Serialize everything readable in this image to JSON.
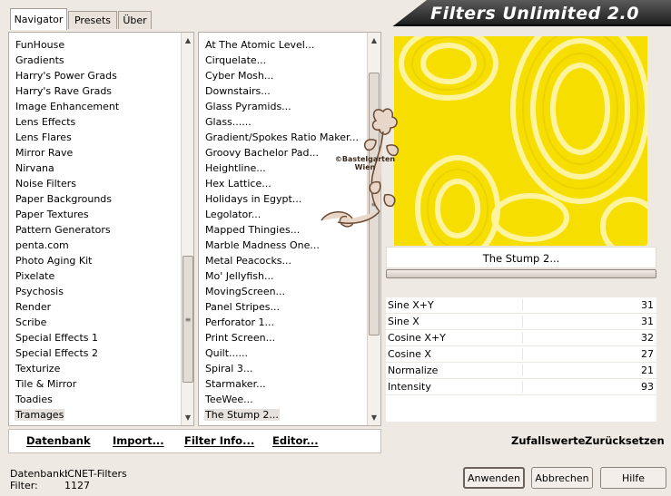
{
  "tabs": [
    "Navigator",
    "Presets",
    "Über"
  ],
  "app_title": "Filters Unlimited 2.0",
  "watermark": "©Bastelgarten Wien",
  "categories": [
    "FunHouse",
    "Gradients",
    "Harry's Power Grads",
    "Harry's Rave Grads",
    "Image Enhancement",
    "Lens Effects",
    "Lens Flares",
    "Mirror Rave",
    "Nirvana",
    "Noise Filters",
    "Paper Backgrounds",
    "Paper Textures",
    "Pattern Generators",
    "penta.com",
    "Photo Aging Kit",
    "Pixelate",
    "Psychosis",
    "Render",
    "Scribe",
    "Special Effects 1",
    "Special Effects 2",
    "Texturize",
    "Tile & Mirror",
    "Toadies",
    "Tramages"
  ],
  "selected_category": "Tramages",
  "filters": [
    "At The Atomic Level...",
    "Cirquelate...",
    "Cyber Mosh...",
    "Downstairs...",
    "Glass Pyramids...",
    "Glass......",
    "Gradient/Spokes Ratio Maker...",
    "Groovy Bachelor Pad...",
    "Heightline...",
    "Hex Lattice...",
    "Holidays in Egypt...",
    "Legolator...",
    "Mapped Thingies...",
    "Marble Madness One...",
    "Metal Peacocks...",
    "Mo' Jellyfish...",
    "MovingScreen...",
    "Panel Stripes...",
    "Perforator 1...",
    "Print Screen...",
    "Quilt......",
    "Spiral 3...",
    "Starmaker...",
    "TeeWee...",
    "The Stump 2..."
  ],
  "selected_filter": "The Stump 2...",
  "toolbar": {
    "database": "Datenbank",
    "import": "Import...",
    "filter_info": "Filter Info...",
    "editor": "Editor..."
  },
  "current_filter_name": "The Stump 2...",
  "parameters": [
    {
      "name": "Sine X+Y",
      "value": "31"
    },
    {
      "name": "Sine X",
      "value": "31"
    },
    {
      "name": "Cosine X+Y",
      "value": "32"
    },
    {
      "name": "Cosine X",
      "value": "27"
    },
    {
      "name": "Normalize",
      "value": "21"
    },
    {
      "name": "Intensity",
      "value": "93"
    }
  ],
  "random_values": "Zufallswerte",
  "reset": "Zurücksetzen",
  "status": {
    "database_label": "Datenbank:",
    "database_value": "ICNET-Filters",
    "filter_label": "Filter:",
    "filter_value": "1127"
  },
  "buttons": {
    "apply": "Anwenden",
    "cancel": "Abbrechen",
    "help": "Hilfe"
  },
  "colors": {
    "preview": "#f7e000",
    "background": "#efe9e3"
  }
}
